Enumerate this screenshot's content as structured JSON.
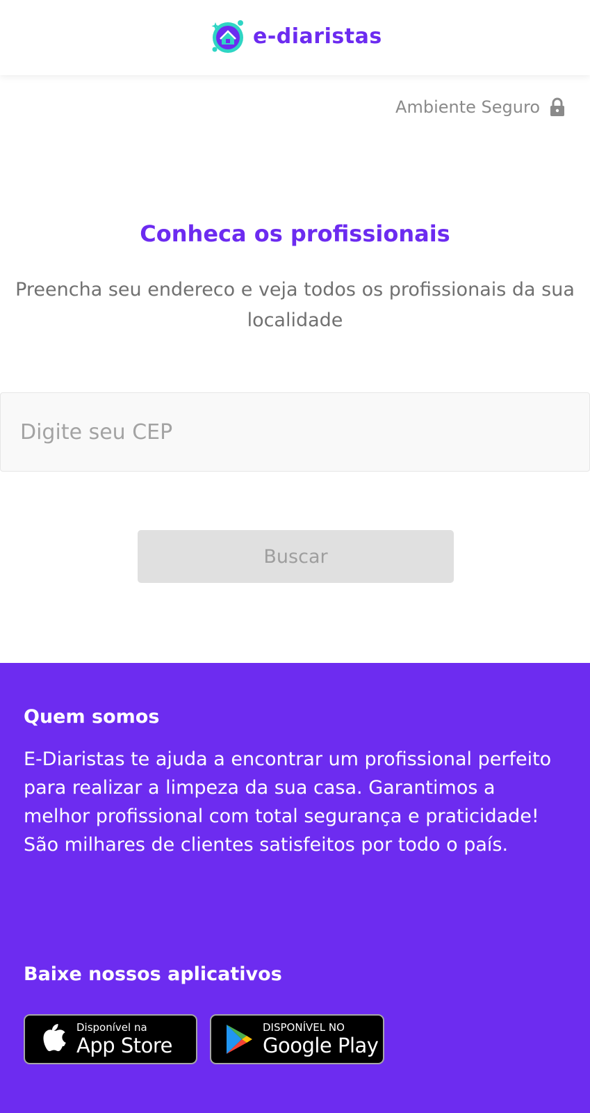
{
  "header": {
    "brand": "e-diaristas",
    "secure_label": "Ambiente Seguro"
  },
  "hero": {
    "title": "Conheca os profissionais",
    "subtitle": "Preencha seu endereco e veja todos os profissionais da sua localidade"
  },
  "search": {
    "cep_placeholder": "Digite seu CEP",
    "cep_value": "",
    "button_label": "Buscar"
  },
  "footer": {
    "about_title": "Quem somos",
    "about_text": "E-Diaristas te ajuda a encontrar um profissional perfeito para realizar a limpeza da sua casa. Garantimos a melhor profissional com total segurança e praticidade! São milhares de clientes satisfeitos por todo o país.",
    "apps_title": "Baixe nossos aplicativos",
    "app_store": {
      "small": "Disponível na",
      "big": "App Store"
    },
    "google_play": {
      "small": "DISPONÍVEL NO",
      "big": "Google Play"
    }
  },
  "colors": {
    "brand_purple": "#6c2bf0",
    "footer_bg": "#6d2cf0",
    "logo_teal": "#2fd5c4"
  },
  "icons": [
    "logo-house-icon",
    "lock-icon",
    "apple-icon",
    "google-play-icon"
  ]
}
